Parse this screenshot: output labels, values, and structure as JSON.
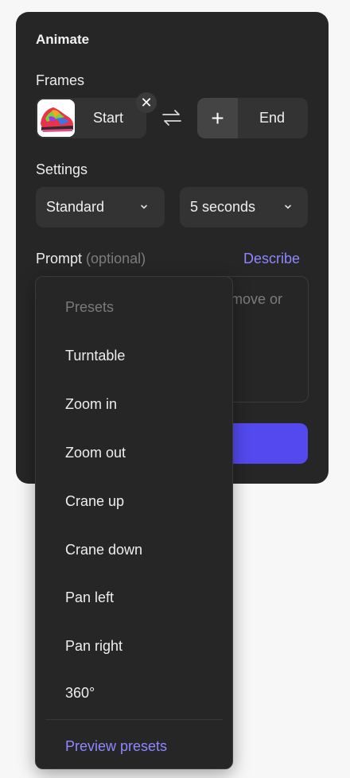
{
  "panel": {
    "title": "Animate",
    "frames_label": "Frames",
    "start_label": "Start",
    "end_label": "End",
    "settings_label": "Settings",
    "quality_value": "Standard",
    "duration_value": "5 seconds",
    "prompt_label": "Prompt",
    "prompt_optional": "(optional)",
    "describe_label": "Describe",
    "prompt_placeholder_visible": "move or"
  },
  "presets_menu": {
    "header": "Presets",
    "items": [
      "Turntable",
      "Zoom in",
      "Zoom out",
      "Crane up",
      "Crane down",
      "Pan left",
      "Pan right",
      "360°"
    ],
    "footer": "Preview presets"
  },
  "colors": {
    "accent": "#5449ee",
    "link": "#8f87ff",
    "panel_bg": "#262626"
  }
}
